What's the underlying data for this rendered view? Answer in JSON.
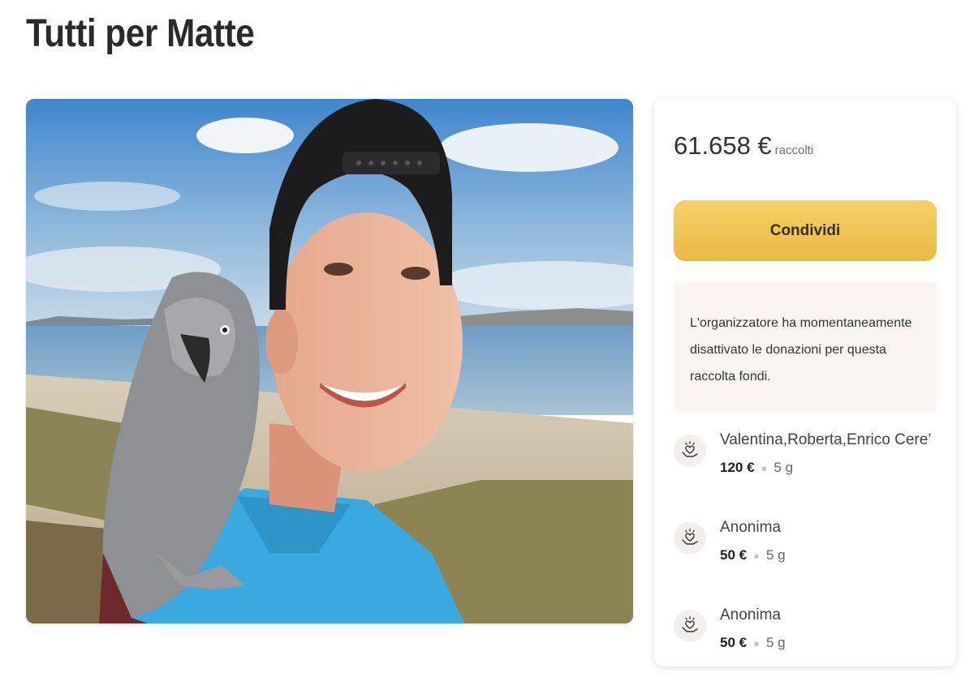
{
  "page": {
    "title": "Tutti per Matte"
  },
  "campaign": {
    "raised_amount": "61.658 €",
    "raised_label": "raccolti",
    "share_label": "Condividi",
    "notice": "L'organizzatore ha momentaneamente disattivato le donazioni per questa raccolta fondi."
  },
  "donations": [
    {
      "name": "Valentina,Roberta,Enrico Cere’",
      "amount": "120 €",
      "time": "5 g",
      "icon": "heart-hand-icon"
    },
    {
      "name": "Anonima",
      "amount": "50 €",
      "time": "5 g",
      "icon": "heart-hand-icon"
    },
    {
      "name": "Anonima",
      "amount": "50 €",
      "time": "5 g",
      "icon": "heart-hand-icon"
    }
  ],
  "colors": {
    "share_button": "#f2c94c",
    "notice_bg": "#fbf6f1",
    "sky": "#4f8fd1",
    "shirt": "#3aa9e0"
  }
}
